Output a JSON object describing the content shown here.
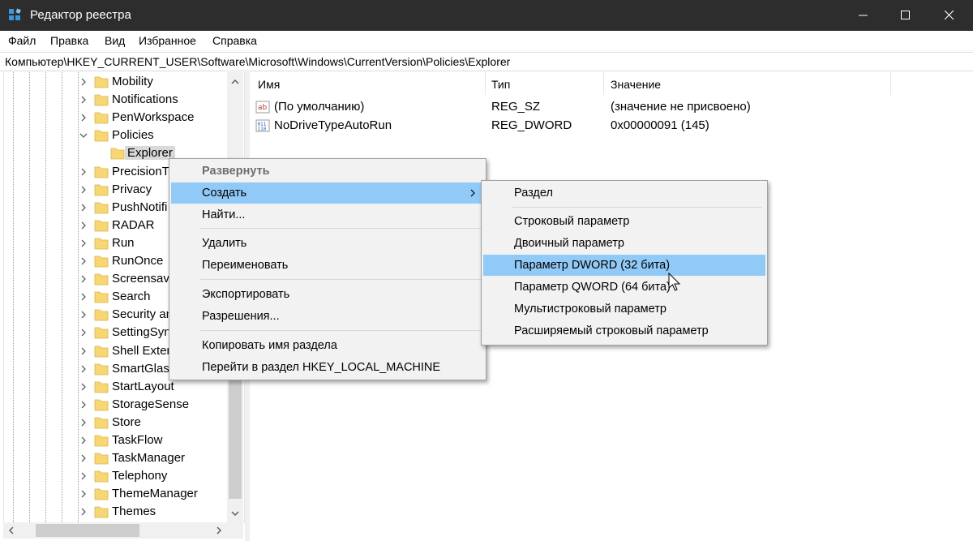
{
  "window": {
    "title": "Редактор реестра",
    "icon": "regedit-icon",
    "controls": [
      "minimize-icon",
      "maximize-icon",
      "close-icon"
    ]
  },
  "menubar": [
    "Файл",
    "Правка",
    "Вид",
    "Избранное",
    "Справка"
  ],
  "address": "Компьютер\\HKEY_CURRENT_USER\\Software\\Microsoft\\Windows\\CurrentVersion\\Policies\\Explorer",
  "tree": {
    "items": [
      {
        "label": "Mobility",
        "expanded": false
      },
      {
        "label": "Notifications",
        "expanded": false
      },
      {
        "label": "PenWorkspace",
        "expanded": false
      },
      {
        "label": "Policies",
        "expanded": true
      },
      {
        "label": "Explorer",
        "child": true,
        "selected": true
      },
      {
        "label": "PrecisionTo",
        "expanded": false
      },
      {
        "label": "Privacy",
        "expanded": false
      },
      {
        "label": "PushNotifi",
        "expanded": false
      },
      {
        "label": "RADAR",
        "expanded": false
      },
      {
        "label": "Run",
        "expanded": false
      },
      {
        "label": "RunOnce",
        "expanded": false
      },
      {
        "label": "Screensave",
        "expanded": false
      },
      {
        "label": "Search",
        "expanded": false
      },
      {
        "label": "Security an",
        "expanded": false
      },
      {
        "label": "SettingSyn",
        "expanded": false
      },
      {
        "label": "Shell Exten",
        "expanded": false
      },
      {
        "label": "SmartGlass",
        "expanded": false
      },
      {
        "label": "StartLayout",
        "expanded": false
      },
      {
        "label": "StorageSense",
        "expanded": false
      },
      {
        "label": "Store",
        "expanded": false
      },
      {
        "label": "TaskFlow",
        "expanded": false
      },
      {
        "label": "TaskManager",
        "expanded": false
      },
      {
        "label": "Telephony",
        "expanded": false
      },
      {
        "label": "ThemeManager",
        "expanded": false
      },
      {
        "label": "Themes",
        "expanded": false
      }
    ]
  },
  "list": {
    "columns": [
      "Имя",
      "Тип",
      "Значение"
    ],
    "rows": [
      {
        "icon": "string-value-icon",
        "name": "(По умолчанию)",
        "type": "REG_SZ",
        "value": "(значение не присвоено)"
      },
      {
        "icon": "binary-value-icon",
        "name": "NoDriveTypeAutoRun",
        "type": "REG_DWORD",
        "value": "0x00000091 (145)"
      }
    ]
  },
  "context_menu": {
    "items": [
      "Развернуть",
      "Создать",
      "Найти...",
      "Удалить",
      "Переименовать",
      "Экспортировать",
      "Разрешения...",
      "Копировать имя раздела",
      "Перейти в раздел HKEY_LOCAL_MACHINE"
    ],
    "disabled_index": 0,
    "highlighted_index": 1
  },
  "submenu": {
    "items": [
      "Раздел",
      "Строковый параметр",
      "Двоичный параметр",
      "Параметр DWORD (32 бита)",
      "Параметр QWORD (64 бита)",
      "Мультистроковый параметр",
      "Расширяемый строковый параметр"
    ],
    "highlighted_index": 3
  },
  "colors": {
    "titlebar": "#2d2d2d",
    "menu_highlight": "#91c9f7",
    "folder": "#f7d774",
    "selection": "#d9d9d9"
  }
}
